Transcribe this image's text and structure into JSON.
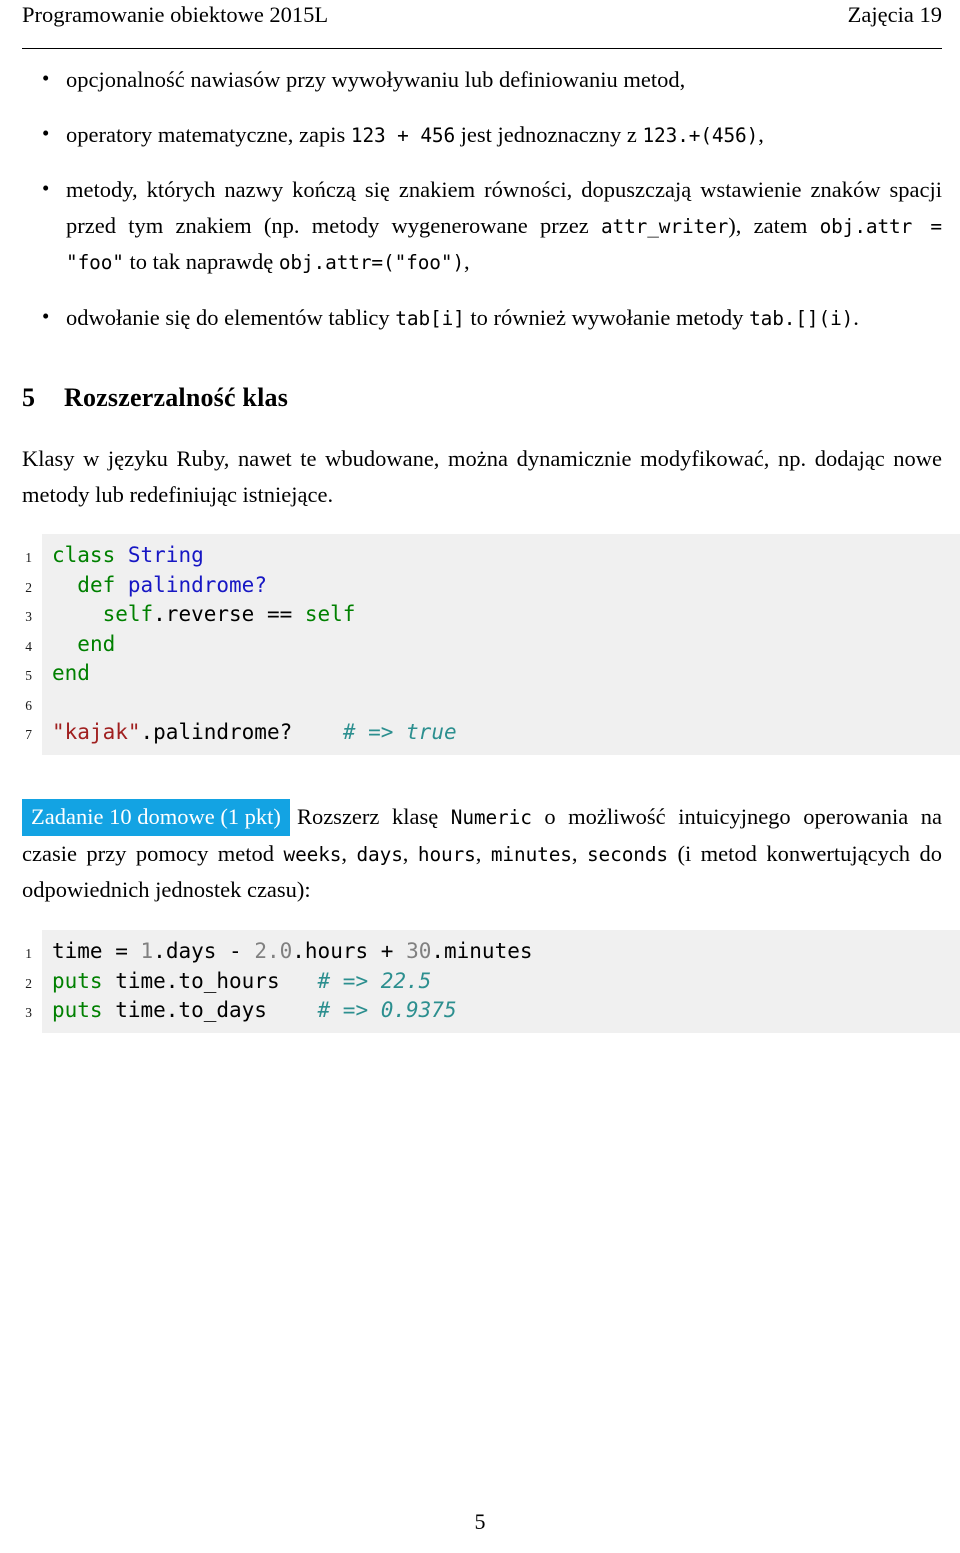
{
  "header": {
    "left": "Programowanie obiektowe 2015L",
    "right": "Zajęcia 19"
  },
  "bullets": [
    {
      "parts": [
        {
          "type": "text",
          "text": "opcjonalność nawiasów przy wywoływaniu lub definiowaniu metod,"
        }
      ]
    },
    {
      "parts": [
        {
          "type": "text",
          "text": "operatory matematyczne, zapis "
        },
        {
          "type": "code",
          "text": "123 + 456"
        },
        {
          "type": "text",
          "text": " jest jednoznaczny z "
        },
        {
          "type": "code",
          "text": "123.+(456)"
        },
        {
          "type": "text",
          "text": ","
        }
      ]
    },
    {
      "parts": [
        {
          "type": "text",
          "text": "metody, których nazwy kończą się znakiem równości, dopuszczają wstawienie znaków spacji przed tym znakiem (np. metody wygenerowane przez "
        },
        {
          "type": "code",
          "text": "attr_writer"
        },
        {
          "type": "text",
          "text": "), zatem "
        },
        {
          "type": "code",
          "text": "obj.attr = \"foo\""
        },
        {
          "type": "text",
          "text": " to tak naprawdę "
        },
        {
          "type": "code",
          "text": "obj.attr=(\"foo\")"
        },
        {
          "type": "text",
          "text": ","
        }
      ]
    },
    {
      "parts": [
        {
          "type": "text",
          "text": "odwołanie się do elementów tablicy "
        },
        {
          "type": "code",
          "text": "tab[i]"
        },
        {
          "type": "text",
          "text": " to również wywołanie metody "
        },
        {
          "type": "code",
          "text": "tab.[](i)"
        },
        {
          "type": "text",
          "text": "."
        }
      ]
    }
  ],
  "section": {
    "number": "5",
    "title": "Rozszerzalność klas"
  },
  "intro_paragraph": "Klasy w języku Ruby, nawet te wbudowane, można dynamicznie modyfikować, np. dodając nowe metody lub redefiniując istniejące.",
  "listing1": {
    "lines": [
      {
        "no": "1",
        "tokens": [
          {
            "c": "k",
            "t": "class"
          },
          {
            "c": "p",
            "t": " "
          },
          {
            "c": "t",
            "t": "String"
          }
        ]
      },
      {
        "no": "2",
        "tokens": [
          {
            "c": "p",
            "t": "  "
          },
          {
            "c": "k",
            "t": "def"
          },
          {
            "c": "p",
            "t": " "
          },
          {
            "c": "t",
            "t": "palindrome?"
          }
        ]
      },
      {
        "no": "3",
        "tokens": [
          {
            "c": "p",
            "t": "    "
          },
          {
            "c": "k",
            "t": "self"
          },
          {
            "c": "p",
            "t": ".reverse == "
          },
          {
            "c": "k",
            "t": "self"
          }
        ]
      },
      {
        "no": "4",
        "tokens": [
          {
            "c": "p",
            "t": "  "
          },
          {
            "c": "k",
            "t": "end"
          }
        ]
      },
      {
        "no": "5",
        "tokens": [
          {
            "c": "k",
            "t": "end"
          }
        ]
      },
      {
        "no": "6",
        "tokens": [
          {
            "c": "p",
            "t": ""
          }
        ]
      },
      {
        "no": "7",
        "tokens": [
          {
            "c": "s",
            "t": "\"kajak\""
          },
          {
            "c": "p",
            "t": ".palindrome?    "
          },
          {
            "c": "c",
            "t": "# => true"
          }
        ]
      }
    ]
  },
  "task": {
    "badge": "Zadanie 10 domowe (1 pkt)",
    "parts": [
      {
        "type": "text",
        "text": "Rozszerz klasę "
      },
      {
        "type": "code",
        "text": "Numeric"
      },
      {
        "type": "text",
        "text": " o możliwość intuicyjnego operowania na czasie przy pomocy metod "
      },
      {
        "type": "code",
        "text": "weeks"
      },
      {
        "type": "text",
        "text": ", "
      },
      {
        "type": "code",
        "text": "days"
      },
      {
        "type": "text",
        "text": ", "
      },
      {
        "type": "code",
        "text": "hours"
      },
      {
        "type": "text",
        "text": ", "
      },
      {
        "type": "code",
        "text": "minutes"
      },
      {
        "type": "text",
        "text": ", "
      },
      {
        "type": "code",
        "text": "seconds"
      },
      {
        "type": "text",
        "text": " (i metod konwertujących do odpowiednich jednostek czasu):"
      }
    ]
  },
  "listing2": {
    "lines": [
      {
        "no": "1",
        "tokens": [
          {
            "c": "p",
            "t": "time = "
          },
          {
            "c": "n",
            "t": "1"
          },
          {
            "c": "p",
            "t": ".days - "
          },
          {
            "c": "n",
            "t": "2.0"
          },
          {
            "c": "p",
            "t": ".hours + "
          },
          {
            "c": "n",
            "t": "30"
          },
          {
            "c": "p",
            "t": ".minutes"
          }
        ]
      },
      {
        "no": "2",
        "tokens": [
          {
            "c": "k",
            "t": "puts"
          },
          {
            "c": "p",
            "t": " time.to_hours   "
          },
          {
            "c": "c",
            "t": "# => 22.5"
          }
        ]
      },
      {
        "no": "3",
        "tokens": [
          {
            "c": "k",
            "t": "puts"
          },
          {
            "c": "p",
            "t": " time.to_days    "
          },
          {
            "c": "c",
            "t": "# => 0.9375"
          }
        ]
      }
    ]
  },
  "page_number": "5",
  "colors": {
    "badge_bg": "#13a3e3",
    "code_bg": "#f0f0f0",
    "keyword": "#008000",
    "type": "#1717c4",
    "string": "#a02020",
    "number": "#808080",
    "comment": "#2c8f8f"
  }
}
